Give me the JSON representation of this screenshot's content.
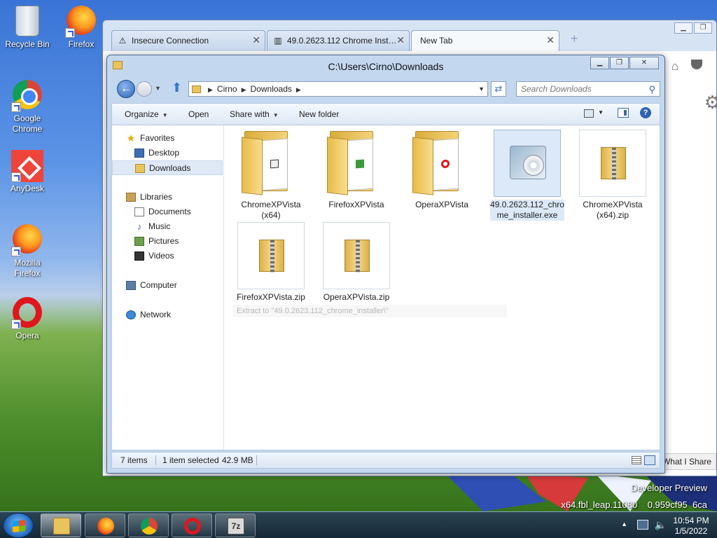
{
  "desktop": {
    "icons": [
      {
        "label": "Recycle Bin"
      },
      {
        "label": "Firefox"
      },
      {
        "label": "Google Chrome"
      },
      {
        "label": "AnyDesk"
      },
      {
        "label": "Mozilla Firefox"
      },
      {
        "label": "Opera"
      }
    ],
    "wallpaper_text": [
      "Developer Preview",
      "x64.fbl_leap.11080",
      "0.959cf95",
      "6ca"
    ]
  },
  "browser": {
    "tabs": [
      {
        "label": "Insecure Connection",
        "icon": "warning-icon"
      },
      {
        "label": "49.0.2623.112 Chrome Inst…",
        "icon": "archive-icon"
      },
      {
        "label": "New Tab",
        "icon": ""
      }
    ],
    "share_button": "What I Share"
  },
  "explorer": {
    "title": "C:\\Users\\Cirno\\Downloads",
    "breadcrumb": [
      "Cirno",
      "Downloads"
    ],
    "search_placeholder": "Search Downloads",
    "toolbar": {
      "organize": "Organize",
      "open": "Open",
      "share_with": "Share with",
      "new_folder": "New folder"
    },
    "nav": {
      "favorites": "Favorites",
      "desktop": "Desktop",
      "downloads": "Downloads",
      "libraries": "Libraries",
      "documents": "Documents",
      "music": "Music",
      "pictures": "Pictures",
      "videos": "Videos",
      "computer": "Computer",
      "network": "Network"
    },
    "files": [
      {
        "name": "ChromeXPVista (x64)",
        "type": "folder"
      },
      {
        "name": "FirefoxXPVista",
        "type": "folder"
      },
      {
        "name": "OperaXPVista",
        "type": "folder"
      },
      {
        "name": "49.0.2623.112_chrome_installer.exe",
        "type": "exe",
        "selected": true
      },
      {
        "name": "ChromeXPVista (x64).zip",
        "type": "zip"
      },
      {
        "name": "FirefoxXPVista.zip",
        "type": "zip"
      },
      {
        "name": "OperaXPVista.zip",
        "type": "zip"
      }
    ],
    "tooltip": "Extract to \"49.0.2623.112_chrome_installer\\\"",
    "status": {
      "items": "7 items",
      "selected": "1 item selected",
      "size": "42.9 MB"
    }
  },
  "taskbar": {
    "apps": [
      "explorer",
      "firefox",
      "chrome",
      "opera",
      "7-zip"
    ],
    "app_glyph_7z": "7z",
    "time": "10:54 PM",
    "date": "1/5/2022"
  }
}
